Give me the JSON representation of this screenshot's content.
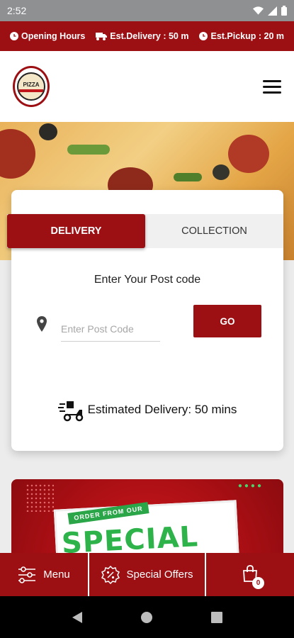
{
  "status_bar": {
    "time": "2:52",
    "icons": [
      "wifi-icon",
      "signal-icon",
      "battery-icon"
    ]
  },
  "info_bar": {
    "opening_hours": "Opening Hours",
    "est_delivery": "Est.Delivery : 50 m",
    "est_pickup": "Est.Pickup : 20 m"
  },
  "header": {
    "logo_text": "PIZZA"
  },
  "order_card": {
    "tabs": [
      {
        "label": "DELIVERY",
        "active": true
      },
      {
        "label": "COLLECTION",
        "active": false
      }
    ],
    "title": "Enter Your Post code",
    "postcode_placeholder": "Enter Post Code",
    "postcode_value": "",
    "go_label": "GO",
    "estimated_delivery": "Estimated Delivery: 50 mins"
  },
  "promo": {
    "tag": "ORDER FROM OUR",
    "headline": "SPECIAL OFFER"
  },
  "bottom_nav": {
    "menu_label": "Menu",
    "offers_label": "Special Offers",
    "cart_count": "0"
  },
  "colors": {
    "brand": "#9c0f13",
    "accent_green": "#2db34a"
  }
}
